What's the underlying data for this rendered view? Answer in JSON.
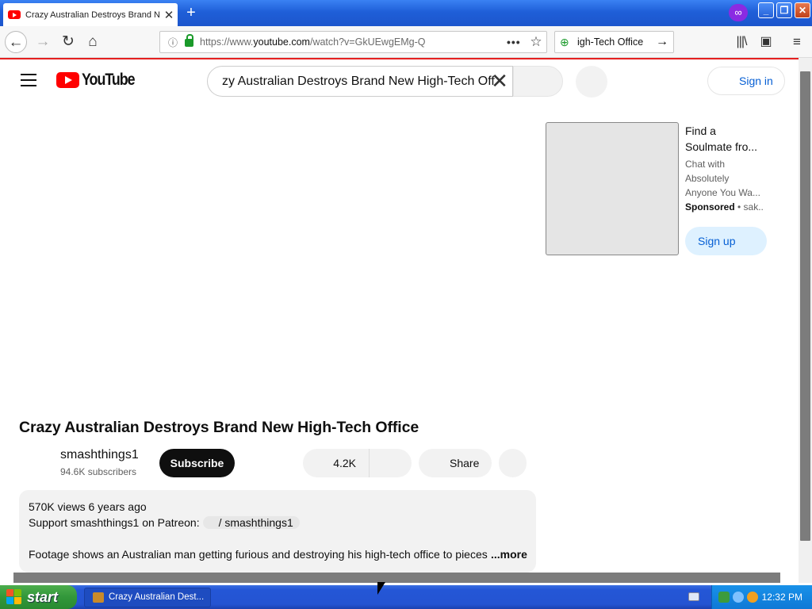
{
  "browser": {
    "tab_title": "Crazy Australian Destroys Brand New High-Tech Office - YouTube",
    "tab_close": "✕",
    "new_tab": "+",
    "url_prefix": "https://www.",
    "url_domain": "youtube.com",
    "url_rest": "/watch?v=GkUEwgEMg-Q",
    "search_text": "igh-Tech Office",
    "window_buttons": {
      "minimize": "_",
      "maximize": "❐",
      "close": "✕"
    }
  },
  "youtube": {
    "logo_text": "YouTube",
    "search_query": "zy Australian Destroys Brand New High-Tech Off",
    "signin_label": "Sign in",
    "ad": {
      "title_line1": "Find a",
      "title_line2": "Soulmate fro...",
      "desc_line1": "Chat with",
      "desc_line2": "Absolutely",
      "desc_line3": "Anyone You Wa...",
      "sponsored": "Sponsored",
      "sponsor_name": " • sak...",
      "cta": "Sign up"
    },
    "video": {
      "title": "Crazy Australian Destroys Brand New High-Tech Office",
      "channel": "smashthings1",
      "subscribers": "94.6K subscribers",
      "subscribe_label": "Subscribe",
      "likes": "4.2K",
      "share_label": "Share",
      "views_date": "570K views  6 years ago",
      "patreon_text": "Support smashthings1 on Patreon:",
      "patreon_link": "/ smashthings1",
      "description": "Footage shows an Australian man getting furious and destroying his high-tech office to pieces",
      "more_label": "...more"
    }
  },
  "taskbar": {
    "start_label": "start",
    "task_item": "Crazy Australian Dest...",
    "clock": "12:32 PM"
  },
  "colors": {
    "titlebar": "#1f5fd8",
    "youtube_red": "#ff0000",
    "link_blue": "#065fd4",
    "taskbar": "#2456d6",
    "start_green": "#32973a"
  }
}
